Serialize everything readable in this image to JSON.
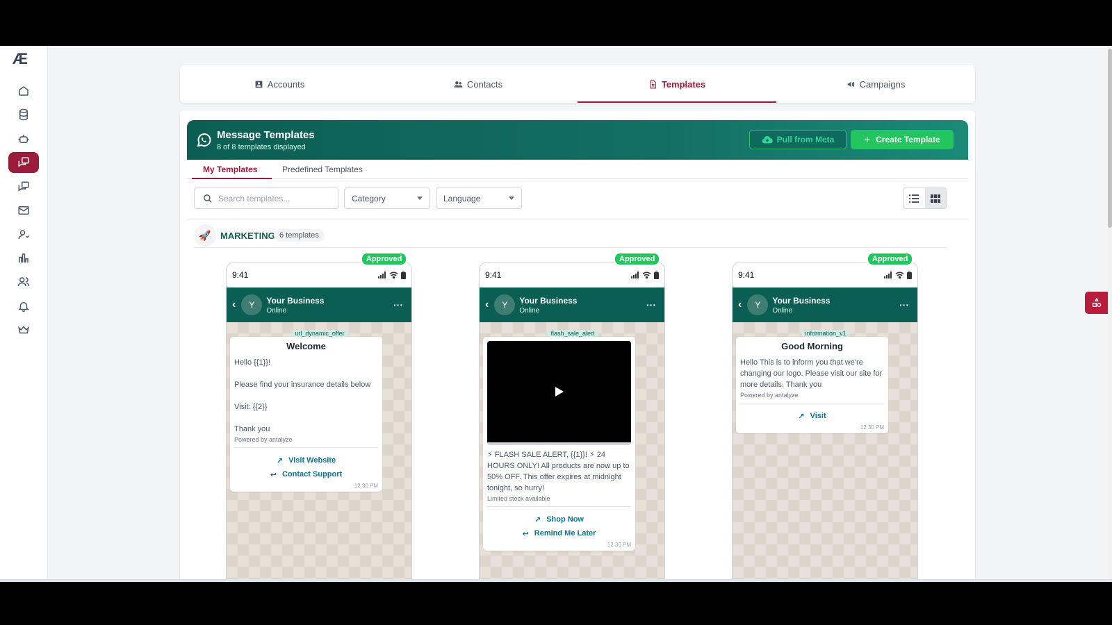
{
  "app": {
    "logo": "Æ"
  },
  "sidebar": {
    "items": [
      {
        "icon": "home-icon"
      },
      {
        "icon": "database-icon"
      },
      {
        "icon": "bot-icon"
      },
      {
        "icon": "templates-chat-icon",
        "active": true
      },
      {
        "icon": "chat-icon"
      },
      {
        "icon": "mail-icon"
      },
      {
        "icon": "user-settings-icon"
      },
      {
        "icon": "bar-chart-icon"
      },
      {
        "icon": "users-icon"
      },
      {
        "icon": "bell-icon"
      },
      {
        "icon": "crown-icon"
      }
    ]
  },
  "top_tabs": [
    {
      "label": "Accounts",
      "icon": "account-box-icon"
    },
    {
      "label": "Contacts",
      "icon": "contacts-icon"
    },
    {
      "label": "Templates",
      "icon": "document-icon",
      "active": true
    },
    {
      "label": "Campaigns",
      "icon": "megaphone-icon"
    }
  ],
  "banner": {
    "title": "Message Templates",
    "subtitle": "8 of 8 templates displayed",
    "pull_label": "Pull from Meta",
    "create_label": "Create Template"
  },
  "sub_tabs": {
    "my": "My Templates",
    "predefined": "Predefined Templates"
  },
  "filters": {
    "search_placeholder": "Search templates...",
    "category": "Category",
    "language": "Language"
  },
  "section": {
    "title": "MARKETING",
    "count": "6 templates"
  },
  "phone_common": {
    "time": "9:41",
    "business": "Your Business",
    "status": "Online",
    "avatar": "Y",
    "badge": "Approved",
    "msg_time": "12:30 PM"
  },
  "templates": [
    {
      "name": "url_dynamic_offer",
      "header": "Welcome",
      "body": "Hello {{1}}!\n\nPlease find your insurance details below\n\nVisit: {{2}}\n\nThank you",
      "footer": "Powered by antalyze",
      "btn1": "Visit Website",
      "btn2": "Contact Support"
    },
    {
      "name": "flash_sale_alert",
      "body": "⚡ FLASH SALE ALERT, {{1}}! ⚡ 24 HOURS ONLY! All products are now up to 50% OFF. This offer expires at midnight tonight, so hurry!",
      "footer": "Limited stock available",
      "btn1": "Shop Now",
      "btn2": "Remind Me Later"
    },
    {
      "name": "information_v1",
      "header": "Good Morning",
      "body": "Hello This is to inform you that we're changing our logo. Please visit our site for more details. Thank you",
      "footer": "Powered by antalyze",
      "btn1": "Visit"
    }
  ],
  "colors": {
    "accent": "#9b1c3a",
    "brand_green": "#0b5e54",
    "success": "#22c55e"
  }
}
